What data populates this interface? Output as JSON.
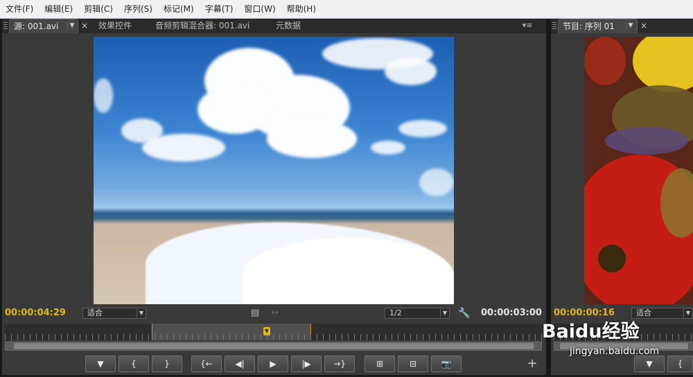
{
  "menu": [
    "文件(F)",
    "编辑(E)",
    "剪辑(C)",
    "序列(S)",
    "标记(M)",
    "字幕(T)",
    "窗口(W)",
    "帮助(H)"
  ],
  "source_panel": {
    "tabs": [
      "源: 001.avi",
      "效果控件",
      "音频剪辑混合器: 001.avi",
      "元数据"
    ],
    "timecode_current": "00:00:04:29",
    "zoom": "适合",
    "resolution": "1/2",
    "timecode_duration": "00:00:03:00",
    "controls": [
      "▼",
      "{",
      "}",
      "{←",
      "◀|",
      "▶",
      "|▶",
      "→}",
      "⊞",
      "⊟",
      "📷"
    ]
  },
  "program_panel": {
    "tab": "节目: 序列 01",
    "timecode_current": "00:00:00:16",
    "zoom": "适合"
  },
  "watermark": {
    "brand": "Baidu经验",
    "url": "jingyan.baidu.com"
  }
}
